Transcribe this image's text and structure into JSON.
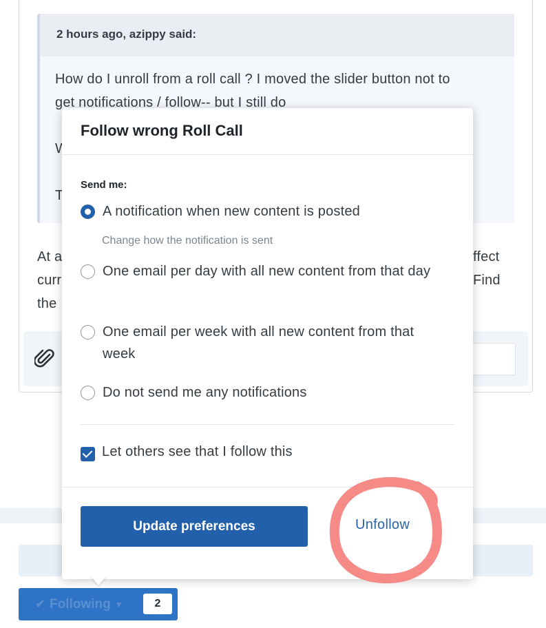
{
  "quote": {
    "header": "2 hours ago, azippy said:",
    "line1": "How do I unroll from a roll call ?  I moved the slider button not to",
    "line2": "get notifications / follow-- but I still do",
    "frag_w": "W",
    "frag_t": "T"
  },
  "post_fragments": {
    "left_line1": "At a",
    "left_line2": "curr",
    "left_line3": "the",
    "right_line1": "ffect",
    "right_line2": "Find"
  },
  "footer": {
    "following_label": "Following",
    "follower_count": "2"
  },
  "dialog": {
    "title": "Follow wrong Roll Call",
    "send_me": "Send me:",
    "options": [
      {
        "label": "A notification when new content is posted",
        "selected": true
      },
      {
        "label": "One email per day with all new content from that day",
        "selected": false
      },
      {
        "label": "One email per week with all new content from that week",
        "selected": false
      },
      {
        "label": "Do not send me any notifications",
        "selected": false
      }
    ],
    "change_link": "Change how the notification is sent",
    "visibility_label": "Let others see that I follow this",
    "visibility_checked": true,
    "update_button": "Update preferences",
    "unfollow_link": "Unfollow"
  },
  "colors": {
    "accent": "#2360ab",
    "annotation": "#f58a87"
  },
  "icons": {
    "attach": "paperclip-icon",
    "following": "check-icon",
    "dropdown": "caret-down-icon"
  }
}
